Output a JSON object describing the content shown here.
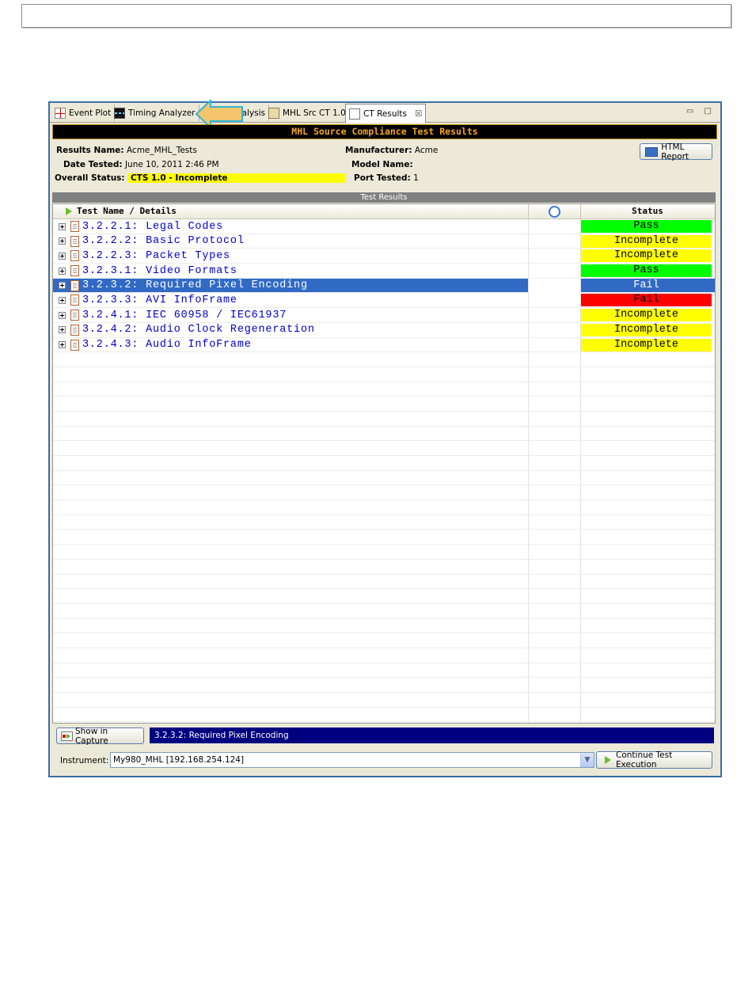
{
  "tabs": [
    {
      "label": "Event Plot",
      "icon": "event-plot-icon"
    },
    {
      "label": "Timing Analyzer",
      "icon": "timing-analyzer-icon"
    },
    {
      "label": "alysis",
      "icon": "analysis-icon"
    },
    {
      "label": "MHL Src CT 1.0",
      "icon": "book-icon"
    },
    {
      "label": "CT Results",
      "icon": "document-icon",
      "close": "☒"
    }
  ],
  "window_controls": {
    "minimize": "▭",
    "maximize": "□"
  },
  "panel_title": "MHL Source Compliance Test Results",
  "info": {
    "results_name_label": "Results Name:",
    "results_name": "Acme_MHL_Tests",
    "date_tested_label": "Date Tested:",
    "date_tested": "June 10, 2011 2:46 PM",
    "overall_status_label": "Overall Status:",
    "overall_status": "CTS 1.0 - Incomplete",
    "manufacturer_label": "Manufacturer:",
    "manufacturer": "Acme",
    "model_name_label": "Model Name:",
    "model_name": "",
    "port_tested_label": "Port Tested:",
    "port_tested": "1"
  },
  "html_report_label": "HTML Report",
  "section_title": "Test Results",
  "columns": {
    "name": "Test Name / Details",
    "status": "Status"
  },
  "rows": [
    {
      "name": "3.2.2.1: Legal Codes",
      "status": "Pass"
    },
    {
      "name": "3.2.2.2: Basic Protocol",
      "status": "Incomplete"
    },
    {
      "name": "3.2.2.3: Packet Types",
      "status": "Incomplete"
    },
    {
      "name": "3.2.3.1: Video Formats",
      "status": "Pass"
    },
    {
      "name": "3.2.3.2: Required Pixel Encoding",
      "status": "Fail"
    },
    {
      "name": "3.2.3.3: AVI InfoFrame",
      "status": "Fail"
    },
    {
      "name": "3.2.4.1: IEC 60958 / IEC61937",
      "status": "Incomplete"
    },
    {
      "name": "3.2.4.2: Audio Clock Regeneration",
      "status": "Incomplete"
    },
    {
      "name": "3.2.4.3: Audio InfoFrame",
      "status": "Incomplete"
    }
  ],
  "selected_row": 4,
  "show_in_capture_label": "Show in Capture",
  "selected_test": "3.2.3.2: Required Pixel Encoding",
  "instrument_label": "Instrument:",
  "instrument_value": "My980_MHL [192.168.254.124]",
  "continue_label": "Continue Test Execution",
  "colors": {
    "pass": "#00ff00",
    "incomplete": "#ffff00",
    "fail": "#ff0000",
    "selection": "#316ac5",
    "title_text": "#f5a623"
  }
}
